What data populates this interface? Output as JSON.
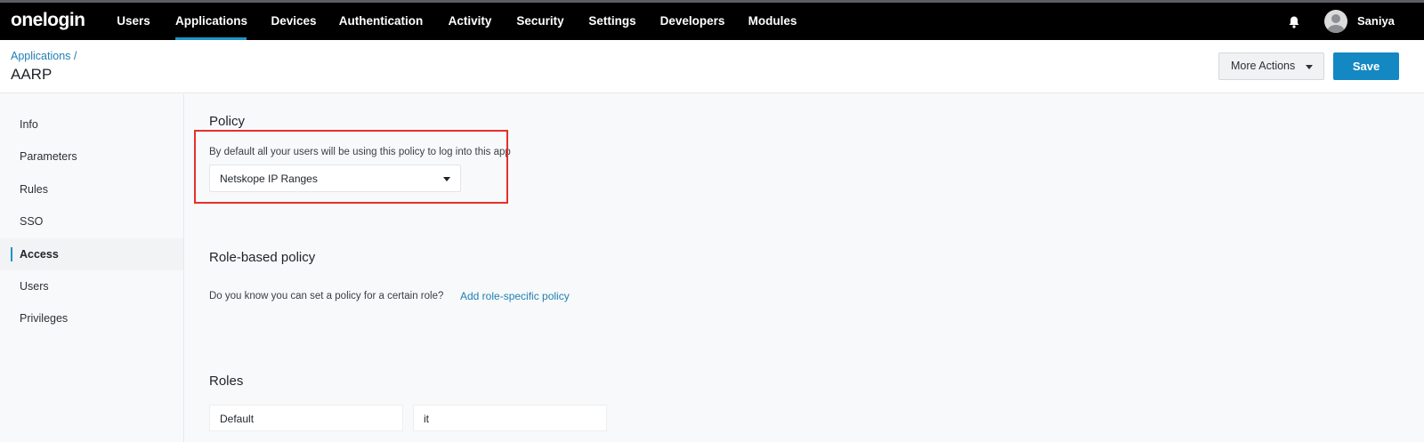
{
  "navbar": {
    "logo": "onelogin",
    "items": [
      {
        "label": "Users",
        "active": false
      },
      {
        "label": "Applications",
        "active": true
      },
      {
        "label": "Devices",
        "active": false
      },
      {
        "label": "Authentication",
        "active": false
      },
      {
        "label": "Activity",
        "active": false
      },
      {
        "label": "Security",
        "active": false
      },
      {
        "label": "Settings",
        "active": false
      },
      {
        "label": "Developers",
        "active": false
      },
      {
        "label": "Modules",
        "active": false
      }
    ],
    "notifications_icon": "bell-icon",
    "user": {
      "name": "Saniya",
      "avatar_icon": "user-avatar-icon"
    }
  },
  "header": {
    "breadcrumb": "Applications /",
    "title": "AARP",
    "more_actions_label": "More Actions",
    "save_label": "Save"
  },
  "sidebar": {
    "items": [
      {
        "label": "Info",
        "active": false
      },
      {
        "label": "Parameters",
        "active": false
      },
      {
        "label": "Rules",
        "active": false
      },
      {
        "label": "SSO",
        "active": false
      },
      {
        "label": "Access",
        "active": true
      },
      {
        "label": "Users",
        "active": false
      },
      {
        "label": "Privileges",
        "active": false
      }
    ]
  },
  "policy": {
    "title": "Policy",
    "hint": "By default all your users will be using this policy to log into this app",
    "selected": "Netskope IP Ranges"
  },
  "role_policy": {
    "title": "Role-based policy",
    "hint": "Do you know you can set a policy for a certain role?",
    "link": "Add role-specific policy"
  },
  "roles": {
    "title": "Roles",
    "items": [
      "Default",
      "it"
    ]
  },
  "colors": {
    "accent": "#1488c2",
    "link": "#1f7fb3",
    "highlight": "#e4302b",
    "navbar": "#000000"
  }
}
